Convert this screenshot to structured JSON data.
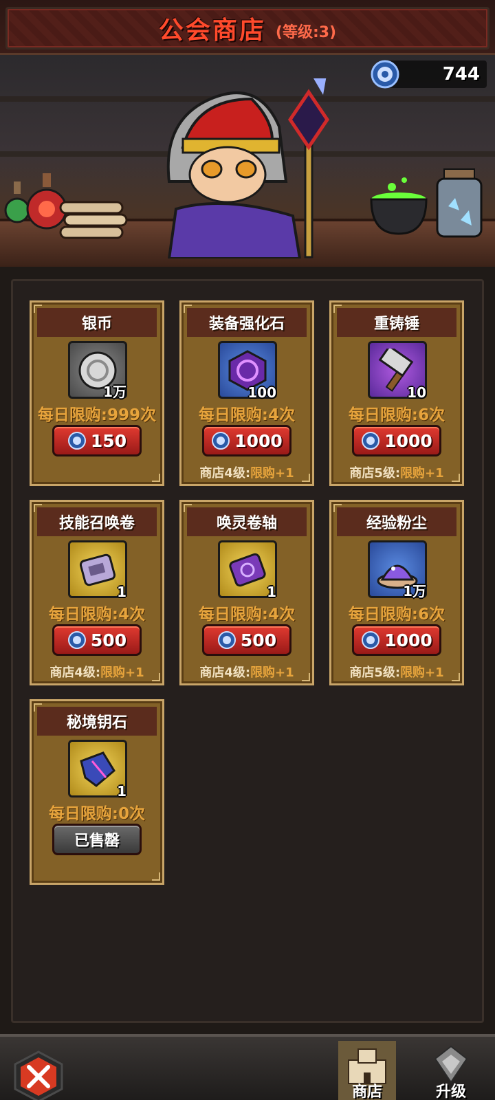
{
  "header": {
    "title": "公会商店",
    "level": "(等级:3)"
  },
  "currency": {
    "icon": "blue-coin-icon",
    "amount": "744"
  },
  "items": [
    {
      "name": "银币",
      "qty": "1万",
      "limit": "每日限购:999次",
      "price": "150",
      "bonus_a": "",
      "bonus_b": "",
      "icon": "silver-coin-icon",
      "box": "grey"
    },
    {
      "name": "装备强化石",
      "qty": "100",
      "limit": "每日限购:4次",
      "price": "1000",
      "bonus_a": "商店4级:",
      "bonus_b": "限购+1",
      "icon": "enhance-stone-icon",
      "box": "blue"
    },
    {
      "name": "重铸锤",
      "qty": "10",
      "limit": "每日限购:6次",
      "price": "1000",
      "bonus_a": "商店5级:",
      "bonus_b": "限购+1",
      "icon": "hammer-icon",
      "box": "purple"
    },
    {
      "name": "技能召唤卷",
      "qty": "1",
      "limit": "每日限购:4次",
      "price": "500",
      "bonus_a": "商店4级:",
      "bonus_b": "限购+1",
      "icon": "skill-scroll-icon",
      "box": "gold"
    },
    {
      "name": "唤灵卷轴",
      "qty": "1",
      "limit": "每日限购:4次",
      "price": "500",
      "bonus_a": "商店4级:",
      "bonus_b": "限购+1",
      "icon": "spirit-scroll-icon",
      "box": "gold"
    },
    {
      "name": "经验粉尘",
      "qty": "1万",
      "limit": "每日限购:6次",
      "price": "1000",
      "bonus_a": "商店5级:",
      "bonus_b": "限购+1",
      "icon": "exp-dust-icon",
      "box": "blue"
    },
    {
      "name": "秘境钥石",
      "qty": "1",
      "limit": "每日限购:0次",
      "price": "",
      "sold": "已售罄",
      "bonus_a": "",
      "bonus_b": "",
      "icon": "key-stone-icon",
      "box": "gold"
    }
  ],
  "nav": {
    "shop_label": "商店",
    "upgrade_label": "升级"
  },
  "colors": {
    "accent": "#e7a43c",
    "title_red": "#ff4a2c",
    "button_red": "#c02a24"
  }
}
